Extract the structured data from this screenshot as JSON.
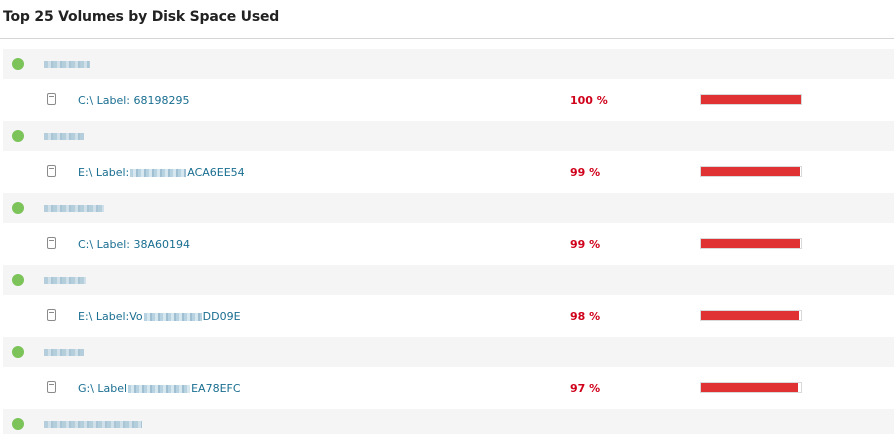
{
  "panel": {
    "title": "Top 25 Volumes by Disk Space Used"
  },
  "colors": {
    "status_up": "#7cc35a",
    "critical": "#d0021b",
    "bar_fill": "#e03232",
    "link": "#1a6e91"
  },
  "icons": {
    "status": "status-up-icon",
    "volume": "disk-volume-icon"
  },
  "rows": [
    {
      "node": {
        "name": "",
        "status": "up"
      },
      "volume": {
        "prefix": "C:\\ Label: 68198295",
        "suffix": "",
        "percent_text": "100 %",
        "percent": 100
      }
    },
    {
      "node": {
        "name": "",
        "status": "up"
      },
      "volume": {
        "prefix": "E:\\ Label:",
        "suffix": "ACA6EE54",
        "percent_text": "99 %",
        "percent": 99
      }
    },
    {
      "node": {
        "name": "",
        "status": "up"
      },
      "volume": {
        "prefix": "C:\\ Label: 38A60194",
        "suffix": "",
        "percent_text": "99 %",
        "percent": 99
      }
    },
    {
      "node": {
        "name": "",
        "status": "up"
      },
      "volume": {
        "prefix": "E:\\ Label:Vo",
        "suffix": "DD09E",
        "percent_text": "98 %",
        "percent": 98
      }
    },
    {
      "node": {
        "name": "",
        "status": "up"
      },
      "volume": {
        "prefix": "G:\\ Label",
        "suffix": "EA78EFC",
        "percent_text": "97 %",
        "percent": 97
      }
    },
    {
      "node": {
        "name": "",
        "status": "up"
      }
    }
  ]
}
